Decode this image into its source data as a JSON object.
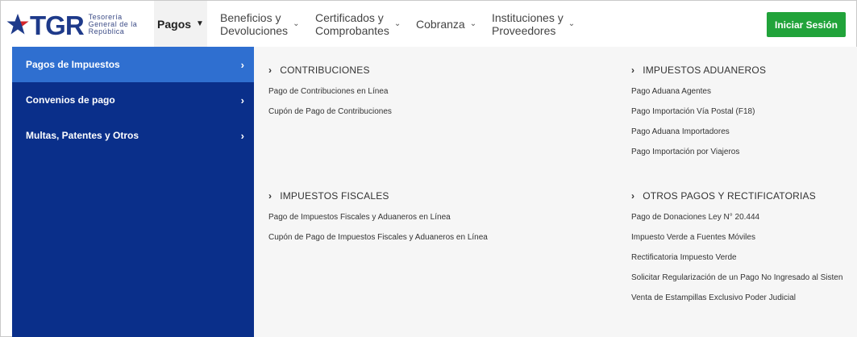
{
  "brand": {
    "logo_text": "TGR",
    "sub_lines": [
      "Tesorería",
      "General de la",
      "República"
    ]
  },
  "nav": {
    "pagos": "Pagos",
    "beneficios": [
      "Beneficios y",
      "Devoluciones"
    ],
    "certificados": [
      "Certificados y",
      "Comprobantes"
    ],
    "cobranza": "Cobranza",
    "instituciones": [
      "Instituciones y",
      "Proveedores"
    ],
    "login": "Iniciar Sesión"
  },
  "sidebar": {
    "items": [
      {
        "label": "Pagos de Impuestos",
        "active": true
      },
      {
        "label": "Convenios de pago",
        "active": false
      },
      {
        "label": "Multas, Patentes y Otros",
        "active": false
      }
    ]
  },
  "sections": {
    "contribuciones": {
      "title": "CONTRIBUCIONES",
      "links": [
        "Pago de Contribuciones en Línea",
        "Cupón de Pago de Contribuciones"
      ]
    },
    "aduaneros": {
      "title": "IMPUESTOS ADUANEROS",
      "links": [
        "Pago Aduana Agentes",
        "Pago Importación Vía Postal (F18)",
        "Pago Aduana Importadores",
        "Pago Importación por Viajeros"
      ]
    },
    "fiscales": {
      "title": "IMPUESTOS FISCALES",
      "links": [
        "Pago de Impuestos Fiscales y Aduaneros en Línea",
        "Cupón de Pago de Impuestos Fiscales y Aduaneros en Línea"
      ]
    },
    "otros": {
      "title": "OTROS PAGOS Y RECTIFICATORIAS",
      "links": [
        "Pago de Donaciones Ley N° 20.444",
        "Impuesto Verde a Fuentes Móviles",
        "Rectificatoria Impuesto Verde",
        "Solicitar Regularización de un Pago No Ingresado al Sisten",
        "Venta de Estampillas Exclusivo Poder Judicial"
      ]
    }
  },
  "colors": {
    "sidebar": "#0a2f8a",
    "sidebar_active": "#2f6fd0",
    "login": "#21a33a",
    "brand": "#1e3a8a"
  }
}
